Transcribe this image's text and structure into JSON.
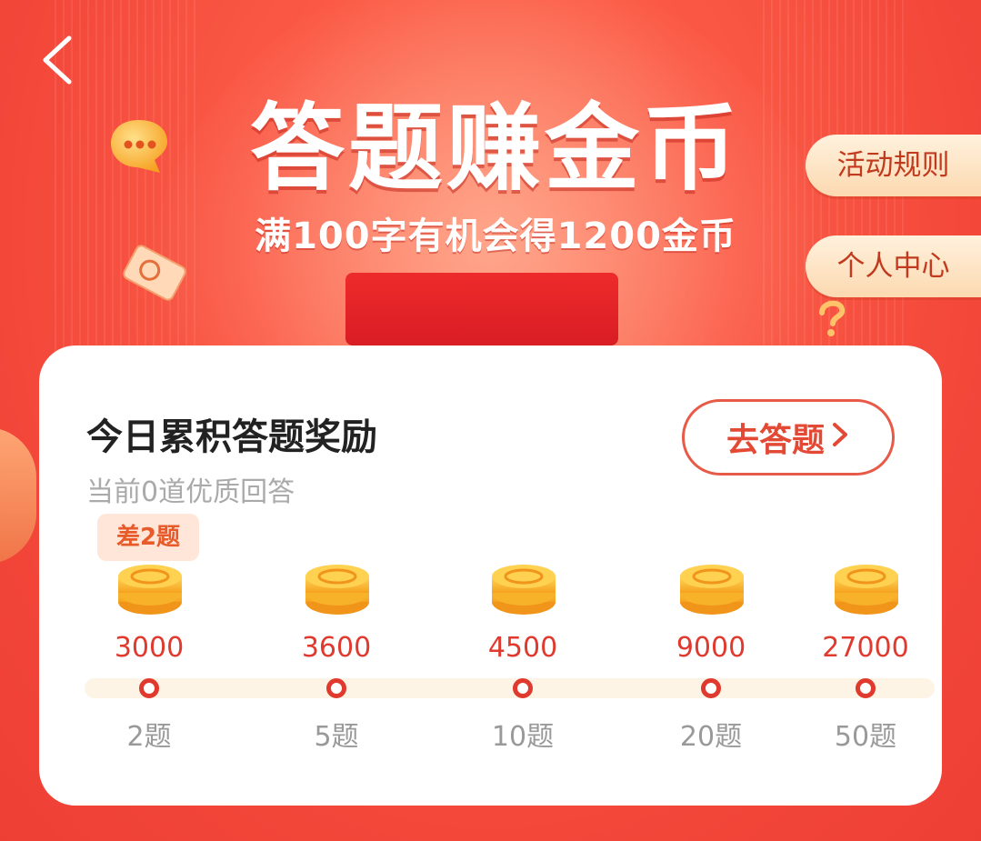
{
  "banner": {
    "title": "答题赚金币",
    "subtitle": "满100字有机会得1200金币"
  },
  "side_buttons": {
    "rules_label": "活动规则",
    "profile_label": "个人中心"
  },
  "card": {
    "title": "今日累积答题奖励",
    "subtitle": "当前0道优质回答",
    "go_button": "去答题",
    "go_button_icon": "chevron-right-icon",
    "badge": "差2题",
    "milestones": [
      {
        "reward": "3000",
        "label": "2题"
      },
      {
        "reward": "3600",
        "label": "5题"
      },
      {
        "reward": "4500",
        "label": "10题"
      },
      {
        "reward": "9000",
        "label": "20题"
      },
      {
        "reward": "27000",
        "label": "50题"
      }
    ]
  },
  "colors": {
    "background": "#f3473a",
    "accent": "#e0392e",
    "side_button_bg": "#fcd9b0",
    "badge_bg": "#ffe6d8"
  },
  "icons": [
    "back-icon",
    "chat-bubble-icon",
    "coin-stack-icon"
  ]
}
